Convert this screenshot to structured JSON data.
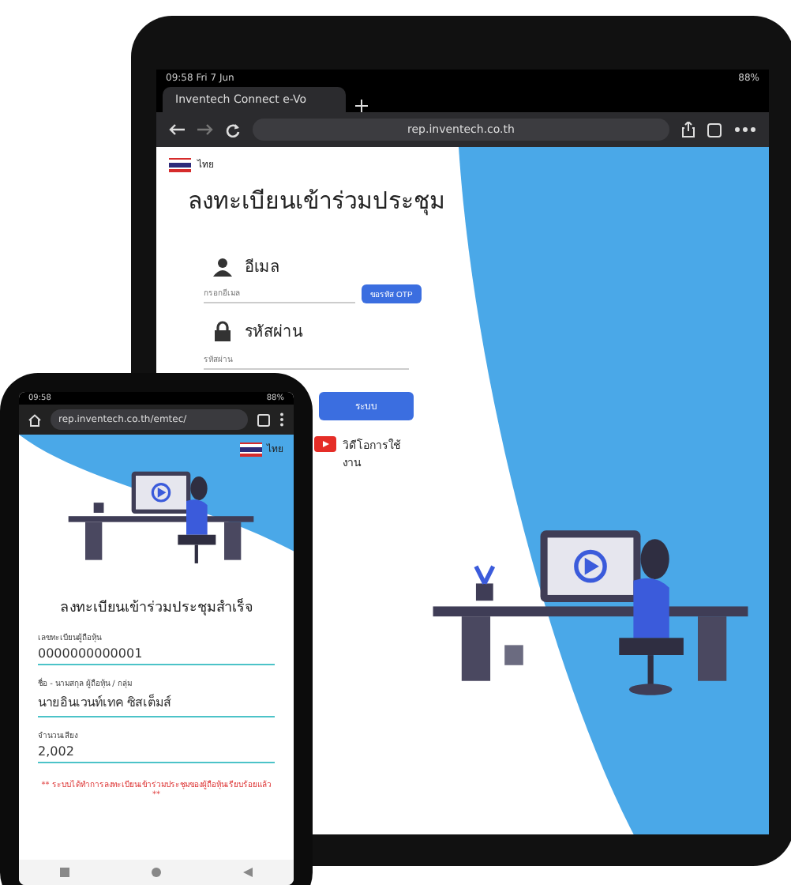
{
  "tablet": {
    "status_bar": {
      "time": "09:58 Fri 7 Jun",
      "battery": "88%"
    },
    "browser": {
      "tab_title": "Inventech Connect e-Vo",
      "url": "rep.inventech.co.th"
    },
    "page": {
      "language": "ไทย",
      "title": "ลงทะเบียนเข้าร่วมประชุม",
      "email": {
        "label": "อีเมล",
        "placeholder": "กรอกอีเมล"
      },
      "otp_button": "ขอรหัส OTP",
      "password": {
        "label": "รหัสผ่าน",
        "placeholder": "รหัสผ่าน"
      },
      "login_button": "ระบบ",
      "video_link": "วิดีโอการใช้งาน"
    }
  },
  "phone": {
    "status_bar": {
      "time": "09:58",
      "battery": "88%"
    },
    "browser": {
      "url": "rep.inventech.co.th/emtec/"
    },
    "page": {
      "language": "ไทย",
      "title": "ลงทะเบียนเข้าร่วมประชุมสำเร็จ",
      "fields": [
        {
          "label": "เลขทะเบียนผู้ถือหุ้น",
          "value": "0000000000001"
        },
        {
          "label": "ชื่อ - นามสกุล ผู้ถือหุ้น / กลุ่ม",
          "value": "นายอินเวนท์เทค ซิสเต็มส์"
        },
        {
          "label": "จำนวนเสียง",
          "value": "2,002"
        }
      ],
      "note": "** ระบบได้ทำการลงทะเบียนเข้าร่วมประชุมของผู้ถือหุ้นเรียบร้อยแล้ว **"
    }
  }
}
